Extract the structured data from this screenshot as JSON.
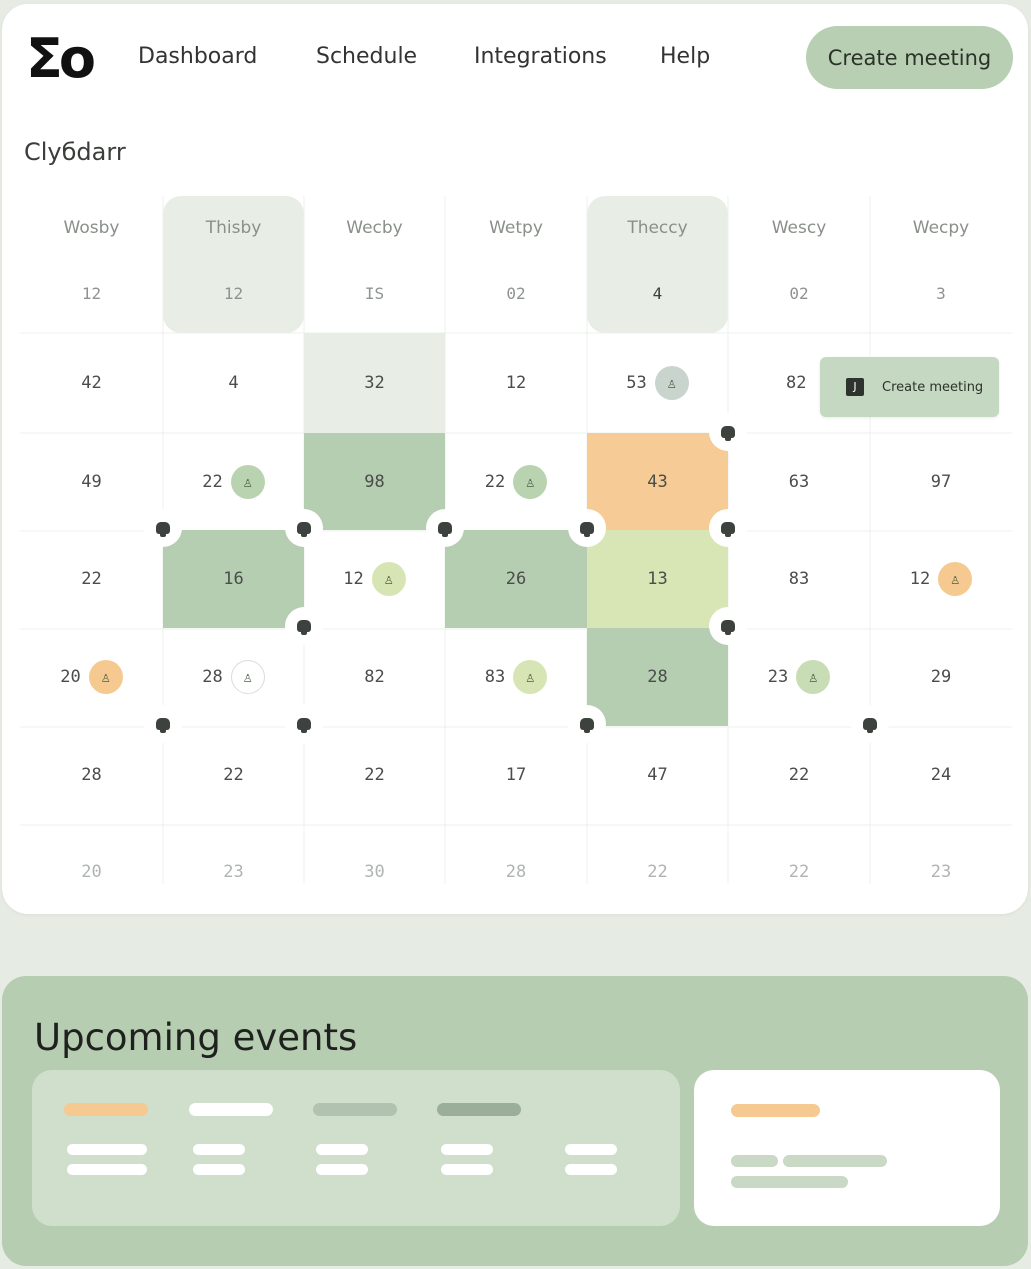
{
  "app": {
    "logo": "Σo"
  },
  "nav": {
    "items": [
      "Dashboard",
      "Schedule",
      "Integrations",
      "Help"
    ],
    "create_label": "Create meeting"
  },
  "page": {
    "title": "Clyбdarr"
  },
  "calendar": {
    "days": [
      {
        "label": "Wosby",
        "date": "12",
        "highlight": false
      },
      {
        "label": "Thisby",
        "date": "12",
        "highlight": true
      },
      {
        "label": "Wecby",
        "date": "IS",
        "highlight": false
      },
      {
        "label": "Wetpy",
        "date": "02",
        "highlight": false
      },
      {
        "label": "Theccy",
        "date": "4",
        "highlight": true
      },
      {
        "label": "Wescy",
        "date": "02",
        "highlight": false
      },
      {
        "label": "Wecpy",
        "date": "3",
        "highlight": false
      }
    ],
    "rows": [
      [
        "42",
        "4",
        "32",
        "12",
        "53",
        "82",
        ""
      ],
      [
        "49",
        "22",
        "98",
        "22",
        "43",
        "63",
        "97"
      ],
      [
        "22",
        "16",
        "12",
        "26",
        "13",
        "83",
        "12"
      ],
      [
        "20",
        "28",
        "82",
        "83",
        "28",
        "23",
        "29"
      ],
      [
        "28",
        "22",
        "22",
        "17",
        "47",
        "22",
        "24"
      ],
      [
        "20",
        "23",
        "30",
        "28",
        "22",
        "22",
        "23"
      ]
    ],
    "tooltip": {
      "label": "Create meeting",
      "icon": "calendar-plus-icon",
      "key": "J"
    }
  },
  "upcoming": {
    "title": "Upcoming events"
  },
  "colors": {
    "accent_green": "#b8cfb3",
    "dark_green": "#b5cdb0",
    "light_green": "#e8eee6",
    "lime": "#d6e5b3",
    "orange": "#f6cb96",
    "badge_orange": "#f5c98f",
    "badge_green": "#c5dca6",
    "badge_gray": "#c9d4cd"
  }
}
